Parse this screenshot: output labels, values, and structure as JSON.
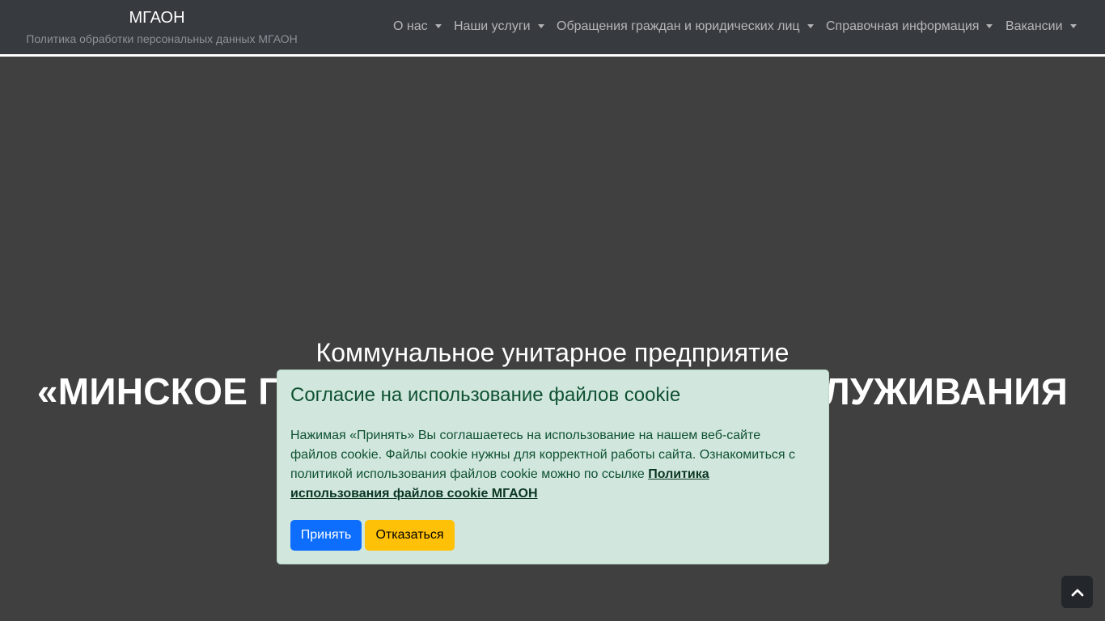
{
  "header": {
    "brand_title": "МГАОН",
    "brand_subtitle": "Политика обработки персональных данных МГАОН",
    "nav": [
      {
        "label": "О нас"
      },
      {
        "label": "Наши услуги"
      },
      {
        "label": "Обращения граждан и юридических лиц"
      },
      {
        "label": "Справочная информация"
      },
      {
        "label": "Вакансии"
      }
    ]
  },
  "hero": {
    "subtitle": "Коммунальное унитарное предприятие",
    "title": "«МИНСКОЕ ГОРОДСКОЕ АГЕНТСТВО ОБСЛУЖИВАНИЯ"
  },
  "cookie": {
    "title": "Согласие на использование файлов cookie",
    "text": "Нажимая «Принять» Вы соглашаетесь на использование на нашем веб-сайте файлов cookie. Файлы cookie нужны для корректной работы сайта. Ознакомиться с политикой использования файлов cookie можно по ссылке",
    "link_label": "Политика использования файлов cookie МГАОН",
    "accept_label": "Принять",
    "decline_label": "Отказаться"
  },
  "icons": {
    "scroll_top": "chevron-up-icon"
  },
  "colors": {
    "navbar_bg": "#373a3f",
    "page_bg": "#404040",
    "cookie_bg": "#d1e7dd",
    "cookie_text": "#0f5132",
    "accept_bg": "#0d6efd",
    "decline_bg": "#ffc107"
  }
}
